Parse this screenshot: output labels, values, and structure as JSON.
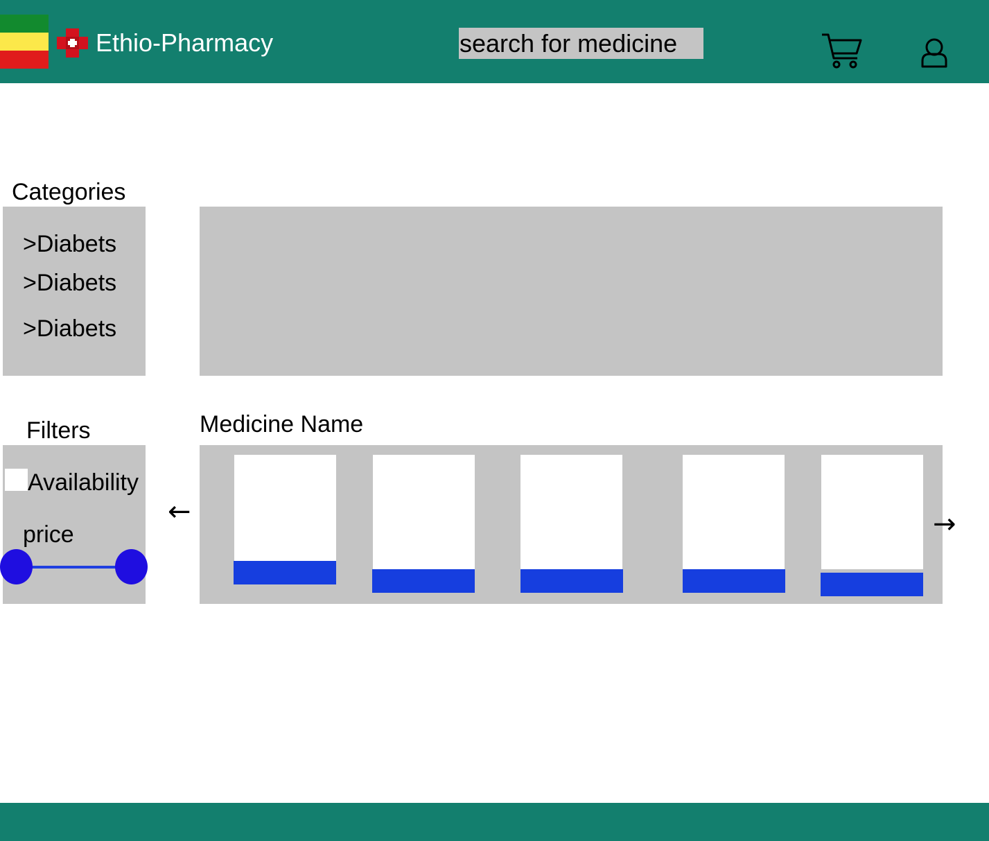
{
  "header": {
    "brand": "Ethio-Pharmacy",
    "search_placeholder": "search for medicine"
  },
  "categories": {
    "title": "Categories",
    "items": [
      ">Diabets",
      ">Diabets",
      ">Diabets"
    ]
  },
  "filters": {
    "title": "Filters",
    "availability_label": "Availability",
    "price_label": "price"
  },
  "products": {
    "title": "Medicine Name",
    "prev_arrow": "←",
    "next_arrow": "→"
  },
  "colors": {
    "header_bg": "#137f6e",
    "panel_gray": "#c4c4c4",
    "button_blue": "#163edf",
    "slider_blue": "#1f0ee0"
  }
}
